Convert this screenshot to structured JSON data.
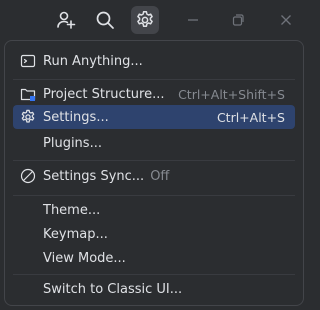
{
  "titlebar": {
    "buttons": [
      {
        "icon": "add-user-icon"
      },
      {
        "icon": "search-icon"
      },
      {
        "icon": "gear-icon",
        "active": true
      },
      {
        "icon": "minimize-icon"
      },
      {
        "icon": "restore-icon"
      },
      {
        "icon": "close-icon"
      }
    ]
  },
  "menu": {
    "run_anything": {
      "label": "Run Anything..."
    },
    "project_structure": {
      "label": "Project Structure...",
      "shortcut": "Ctrl+Alt+Shift+S"
    },
    "settings": {
      "label": "Settings...",
      "shortcut": "Ctrl+Alt+S"
    },
    "plugins": {
      "label": "Plugins..."
    },
    "settings_sync": {
      "label": "Settings Sync...",
      "status": "Off"
    },
    "theme": {
      "label": "Theme..."
    },
    "keymap": {
      "label": "Keymap..."
    },
    "view_mode": {
      "label": "View Mode..."
    },
    "switch_classic": {
      "label": "Switch to Classic UI..."
    }
  },
  "colors": {
    "background": "#2b2d30",
    "selection": "#2e436e",
    "text": "#dfe1e5",
    "muted": "#868a91",
    "project_badge": "#3574f0"
  }
}
